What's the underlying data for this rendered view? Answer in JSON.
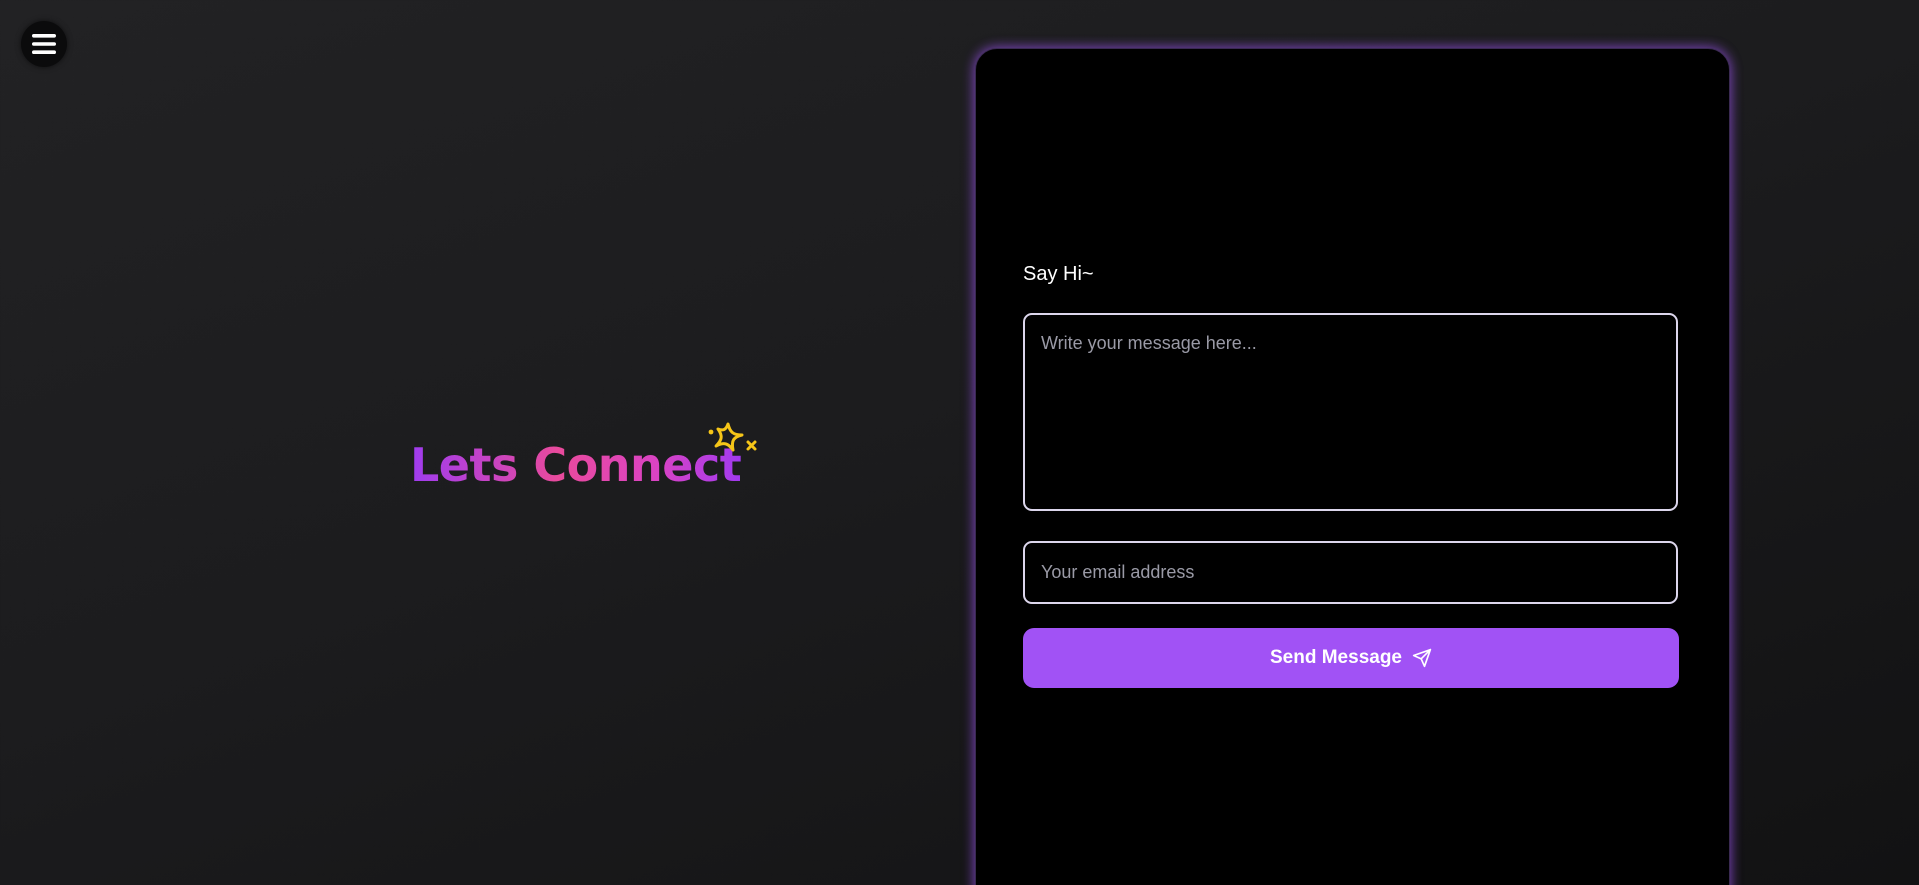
{
  "nav": {
    "menu_icon": "hamburger-menu-icon"
  },
  "hero": {
    "title": "Lets Connect",
    "sparkle_icon": "sparkle-icon",
    "gradient_colors": [
      "#9f3cf0",
      "#e94a9c",
      "#a13af0"
    ],
    "sparkle_color": "#f5c518"
  },
  "contact_form": {
    "heading": "Say Hi~",
    "message_placeholder": "Write your message here...",
    "message_value": "",
    "email_placeholder": "Your email address",
    "email_value": "",
    "send_label": "Send Message",
    "send_icon": "paper-plane-icon",
    "accent_color": "#a152f5"
  }
}
